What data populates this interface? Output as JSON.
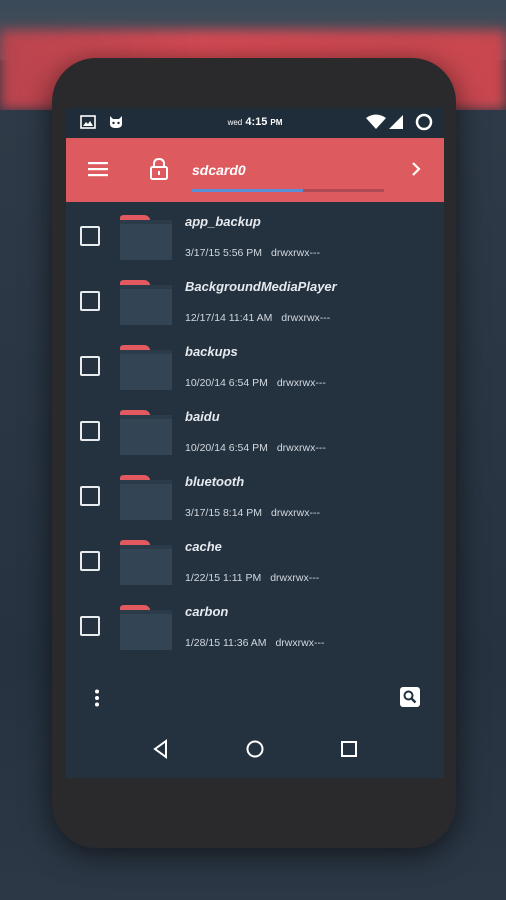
{
  "status_bar": {
    "left_icons": [
      "image-icon",
      "cat-icon"
    ],
    "day": "wed",
    "time": "4:15",
    "ampm": "PM",
    "right_icons": [
      "wifi-icon",
      "cell-signal-icon",
      "circle-icon"
    ]
  },
  "app_bar": {
    "menu_icon": "hamburger-menu-icon",
    "lock_icon": "lock-icon",
    "path": "sdcard0",
    "storage_used_fraction": 0.58,
    "forward_icon": "chevron-right-icon",
    "colors": {
      "bar": "#dd5a5f",
      "progress": "#5a8fd8"
    }
  },
  "files": [
    {
      "name": "app_backup",
      "date": "3/17/15 5:56 PM",
      "permissions": "drwxrwx---"
    },
    {
      "name": "BackgroundMediaPlayer",
      "date": "12/17/14 11:41 AM",
      "permissions": "drwxrwx---"
    },
    {
      "name": "backups",
      "date": "10/20/14 6:54 PM",
      "permissions": "drwxrwx---"
    },
    {
      "name": "baidu",
      "date": "10/20/14 6:54 PM",
      "permissions": "drwxrwx---"
    },
    {
      "name": "bluetooth",
      "date": "3/17/15 8:14 PM",
      "permissions": "drwxrwx---"
    },
    {
      "name": "cache",
      "date": "1/22/15 1:11 PM",
      "permissions": "drwxrwx---"
    },
    {
      "name": "carbon",
      "date": "1/28/15 11:36 AM",
      "permissions": "drwxrwx---"
    }
  ],
  "bottom_actions": {
    "more_icon": "more-vert-icon",
    "search_icon": "search-icon"
  },
  "nav_bar": [
    "back-icon",
    "home-icon",
    "recents-icon"
  ]
}
